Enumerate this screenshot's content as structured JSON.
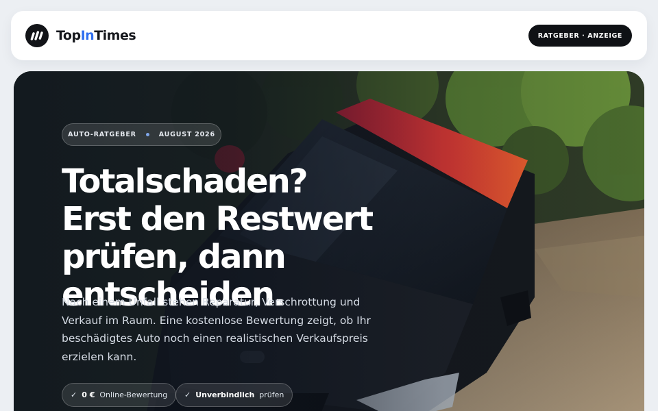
{
  "header": {
    "brand": {
      "part1": "Top",
      "part2": "In",
      "part3": "Times"
    },
    "badge_label": "RATGEBER · ANZEIGE"
  },
  "hero": {
    "chip": {
      "category": "AUTO-RATGEBER",
      "date": "AUGUST 2026"
    },
    "headline": "Totalschaden? Erst den Restwert prüfen, dann entscheiden.",
    "lede": "Nach einem Unfall stehen Reparatur, Verschrottung und Verkauf im Raum. Eine kostenlose Bewertung zeigt, ob Ihr beschädigtes Auto noch einen realistischen Verkaufspreis erzielen kann.",
    "pills": [
      {
        "icon": "check-icon",
        "bold": "0 €",
        "text": "Online-Bewertung"
      },
      {
        "icon": "check-icon",
        "bold": "Unverbindlich",
        "text": "prüfen"
      }
    ]
  },
  "colors": {
    "accent": "#2f6ff0",
    "dark": "#0f1115",
    "car_roof": "#d92a3a",
    "car_body": "#15181d"
  }
}
